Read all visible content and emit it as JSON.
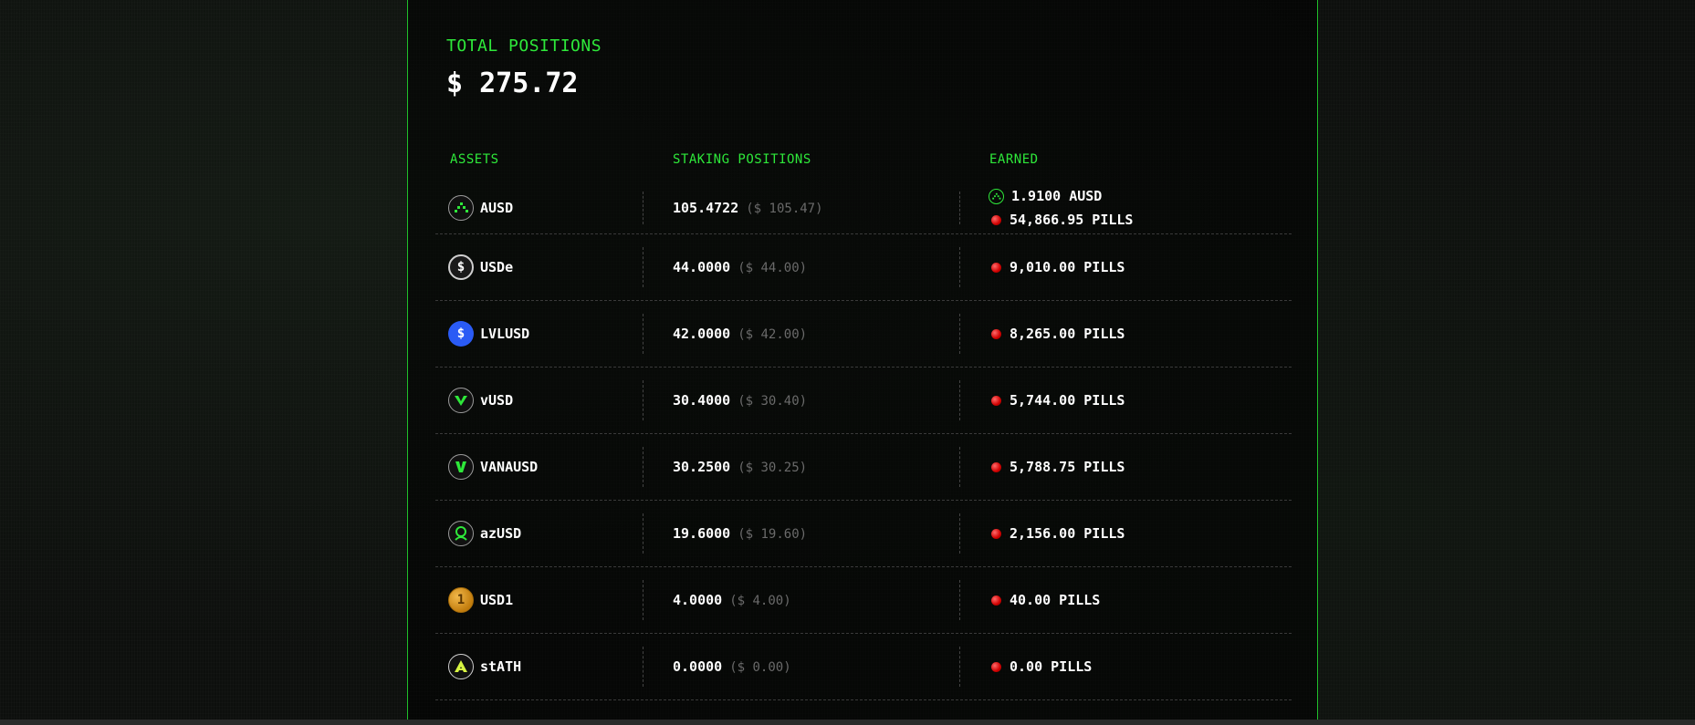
{
  "summary": {
    "label": "TOTAL POSITIONS",
    "value": "$ 275.72"
  },
  "columns": {
    "assets": "ASSETS",
    "staking": "STAKING POSITIONS",
    "earned": "EARNED"
  },
  "rows": [
    {
      "asset": "AUSD",
      "icon": "ausd-icon",
      "amount": "105.4722",
      "usd": "($ 105.47)",
      "earned": [
        {
          "icon": "ausd-mini-icon",
          "text": "1.9100 AUSD"
        },
        {
          "icon": "pill-icon",
          "text": "54,866.95 PILLS"
        }
      ]
    },
    {
      "asset": "USDe",
      "icon": "usde-icon",
      "amount": "44.0000",
      "usd": "($ 44.00)",
      "earned": [
        {
          "icon": "pill-icon",
          "text": "9,010.00 PILLS"
        }
      ]
    },
    {
      "asset": "LVLUSD",
      "icon": "lvlusd-icon",
      "amount": "42.0000",
      "usd": "($ 42.00)",
      "earned": [
        {
          "icon": "pill-icon",
          "text": "8,265.00 PILLS"
        }
      ]
    },
    {
      "asset": "vUSD",
      "icon": "vusd-icon",
      "amount": "30.4000",
      "usd": "($ 30.40)",
      "earned": [
        {
          "icon": "pill-icon",
          "text": "5,744.00 PILLS"
        }
      ]
    },
    {
      "asset": "VANAUSD",
      "icon": "vanausd-icon",
      "amount": "30.2500",
      "usd": "($ 30.25)",
      "earned": [
        {
          "icon": "pill-icon",
          "text": "5,788.75 PILLS"
        }
      ]
    },
    {
      "asset": "azUSD",
      "icon": "azusd-icon",
      "amount": "19.6000",
      "usd": "($ 19.60)",
      "earned": [
        {
          "icon": "pill-icon",
          "text": "2,156.00 PILLS"
        }
      ]
    },
    {
      "asset": "USD1",
      "icon": "usd1-icon",
      "amount": "4.0000",
      "usd": "($ 4.00)",
      "earned": [
        {
          "icon": "pill-icon",
          "text": "40.00 PILLS"
        }
      ]
    },
    {
      "asset": "stATH",
      "icon": "stath-icon",
      "amount": "0.0000",
      "usd": "($ 0.00)",
      "earned": [
        {
          "icon": "pill-icon",
          "text": "0.00 PILLS"
        }
      ]
    }
  ],
  "colors": {
    "accent": "#2ee83a",
    "border": "#1fbf2a",
    "pill": "#d00000",
    "muted": "#6a6a6a"
  }
}
